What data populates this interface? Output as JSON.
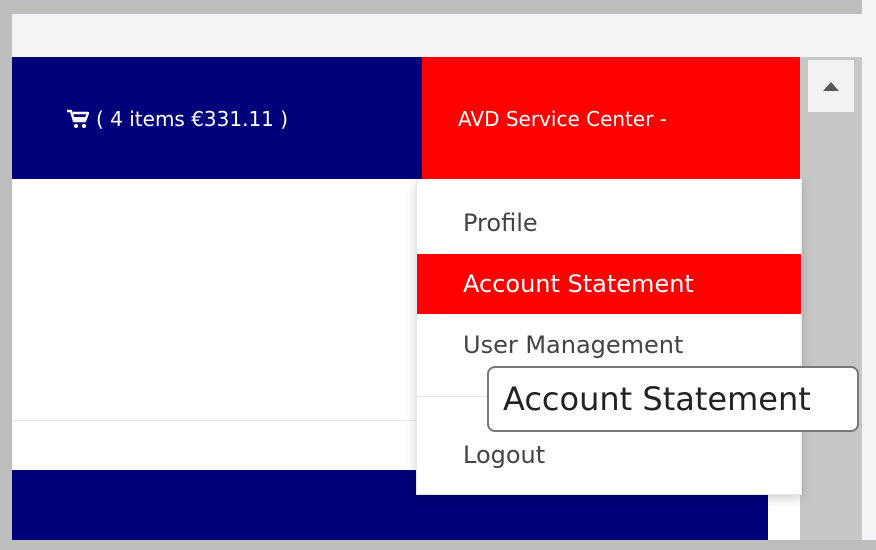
{
  "header": {
    "cart": {
      "icon": "shopping-cart-icon",
      "summary": "( 4 items €331.11 )"
    },
    "account": {
      "label": "AVD Service Center -"
    }
  },
  "account_menu": {
    "items": [
      {
        "label": "Profile"
      },
      {
        "label": "Account Statement"
      },
      {
        "label": "User Management"
      },
      {
        "label": "Logout"
      }
    ],
    "active_item": "Account Statement"
  },
  "tooltip": {
    "text": "Account Statement"
  },
  "colors": {
    "nav_blue": "#00007a",
    "active_red": "#ff0000",
    "white": "#ffffff",
    "scrollbar": "#c7c7c7"
  }
}
